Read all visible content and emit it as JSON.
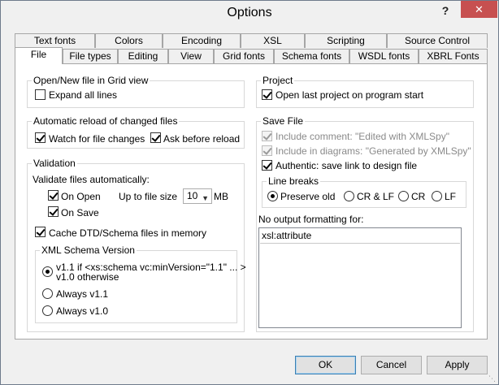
{
  "window": {
    "title": "Options",
    "help": "?",
    "close": "✕"
  },
  "tabs_row1": [
    "Text fonts",
    "Colors",
    "Encoding",
    "XSL",
    "Scripting",
    "Source Control"
  ],
  "tabs_row2": [
    "File",
    "File types",
    "Editing",
    "View",
    "Grid fonts",
    "Schema fonts",
    "WSDL fonts",
    "XBRL Fonts"
  ],
  "open_new": {
    "title": "Open/New file in Grid view",
    "expand_all": "Expand all lines",
    "expand_all_checked": false
  },
  "auto_reload": {
    "title": "Automatic reload of changed files",
    "watch": "Watch for file changes",
    "watch_checked": true,
    "ask": "Ask before reload",
    "ask_checked": true
  },
  "validation": {
    "title": "Validation",
    "validate_auto": "Validate files automatically:",
    "on_open": "On Open",
    "on_open_checked": true,
    "on_save": "On Save",
    "on_save_checked": true,
    "up_to_size": "Up to file size",
    "size_value": "10",
    "size_unit": "MB",
    "cache": "Cache DTD/Schema files in memory",
    "cache_checked": true
  },
  "xml_schema": {
    "title": "XML Schema Version",
    "opt1_line1": "v1.1 if <xs:schema vc:minVersion=\"1.1\" ... >",
    "opt1_line2": "v1.0 otherwise",
    "opt2": "Always v1.1",
    "opt3": "Always v1.0",
    "selected": 0
  },
  "project": {
    "title": "Project",
    "open_last": "Open last project on program start",
    "open_last_checked": true
  },
  "save_file": {
    "title": "Save File",
    "include_comment": "Include comment: \"Edited with XMLSpy\"",
    "include_diagrams": "Include in diagrams: \"Generated by XMLSpy\"",
    "authentic": "Authentic: save link to design file"
  },
  "line_breaks": {
    "title": "Line breaks",
    "options": [
      "Preserve old",
      "CR & LF",
      "CR",
      "LF"
    ],
    "selected": 0
  },
  "no_output": {
    "label": "No output formatting for:",
    "items": [
      "xsl:attribute"
    ]
  },
  "buttons": {
    "ok": "OK",
    "cancel": "Cancel",
    "apply": "Apply"
  }
}
